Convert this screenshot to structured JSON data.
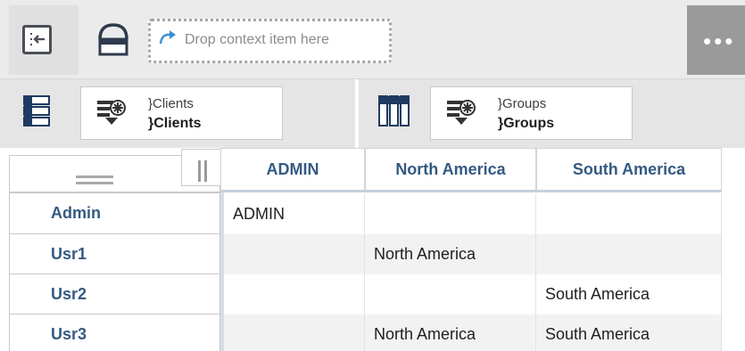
{
  "toolbar": {
    "exit_icon": "exit-panel-icon",
    "context_icon": "context-filter-icon",
    "drop_placeholder": "Drop context item here",
    "more_icon": "more-options-icon",
    "more_label": "•••"
  },
  "edge": {
    "rows_icon": "rows-edge-icon",
    "columns_icon": "columns-edge-icon",
    "rows_chip": {
      "line1": "}Clients",
      "line2": "}Clients"
    },
    "columns_chip": {
      "line1": "}Groups",
      "line2": "}Groups"
    }
  },
  "crosstab": {
    "columns": [
      "ADMIN",
      "North America",
      "South America"
    ],
    "rows": [
      {
        "label": "Admin",
        "cells": [
          "ADMIN",
          "",
          ""
        ]
      },
      {
        "label": "Usr1",
        "cells": [
          "",
          "North America",
          ""
        ]
      },
      {
        "label": "Usr2",
        "cells": [
          "",
          "",
          "South America"
        ]
      },
      {
        "label": "Usr3",
        "cells": [
          "",
          "North America",
          "South America"
        ]
      }
    ]
  },
  "colors": {
    "header_text": "#345a82",
    "toolbar_bg": "#ebebeb",
    "more_bg": "#9a9a9a",
    "accent_arrow": "#3b8fd6"
  }
}
